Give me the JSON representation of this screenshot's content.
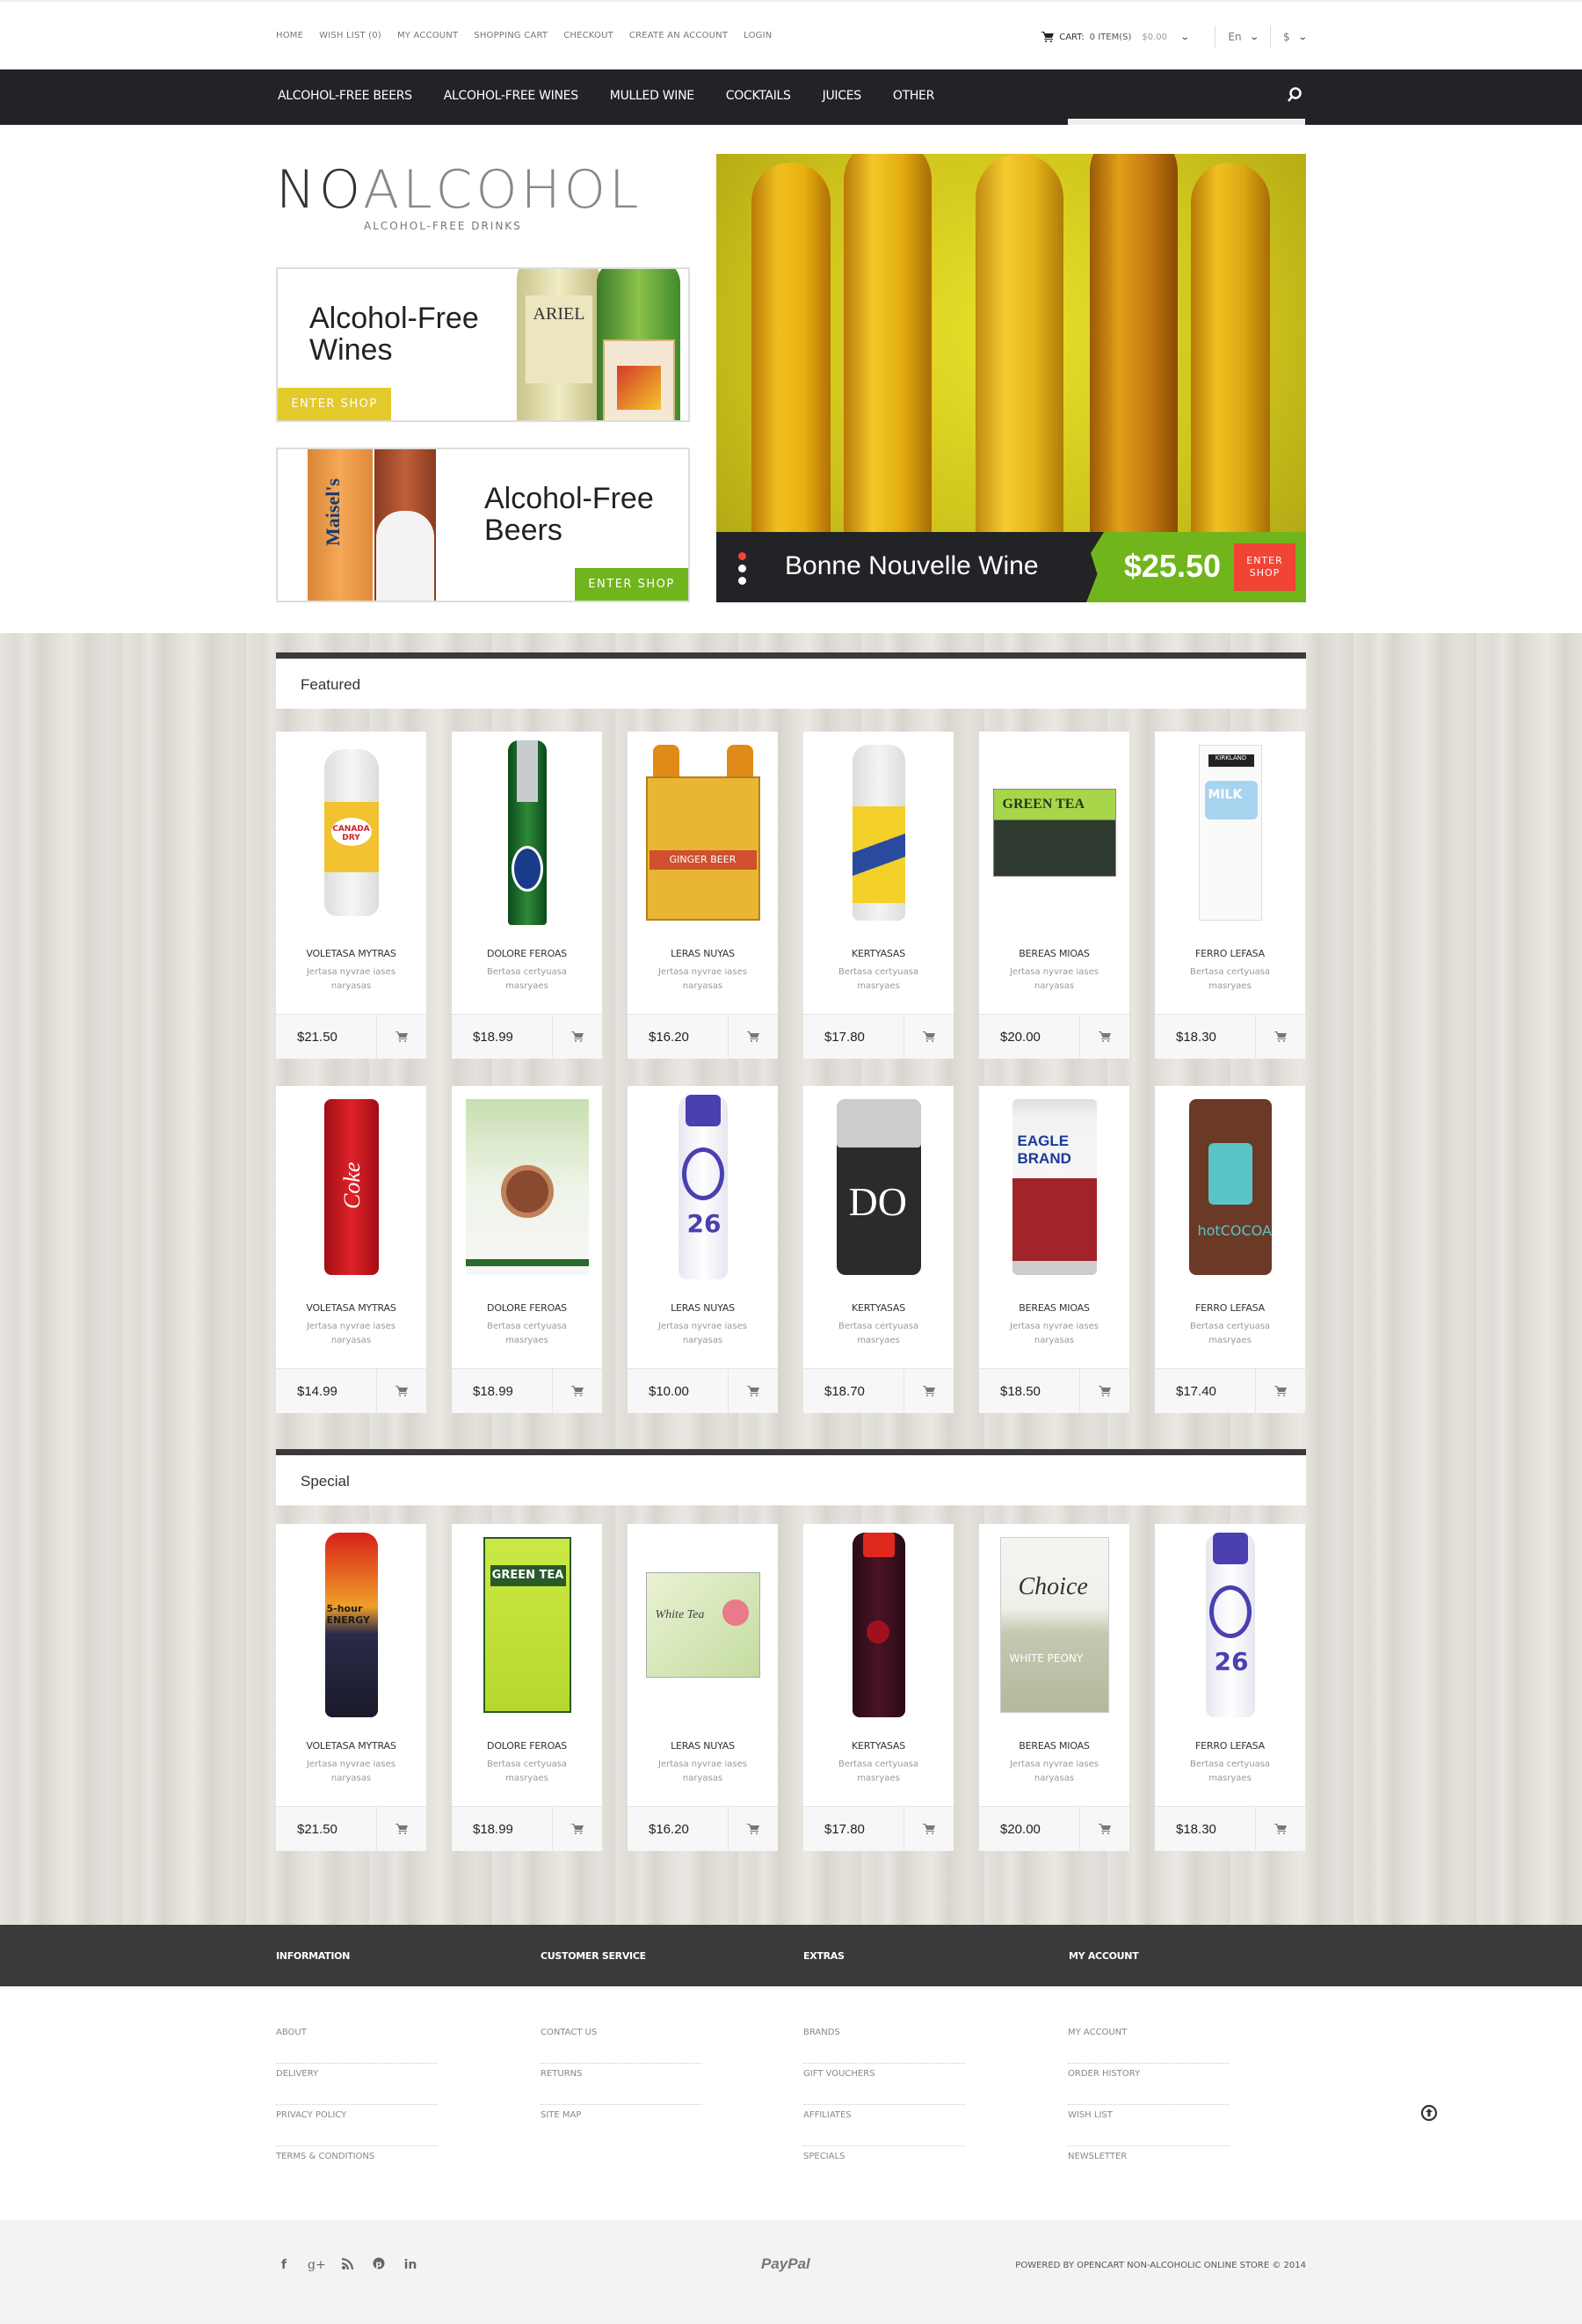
{
  "topbar": {
    "links": [
      "HOME",
      "WISH LIST (0)",
      "MY ACCOUNT",
      "SHOPPING CART",
      "CHECKOUT",
      "CREATE AN ACCOUNT",
      "LOGIN"
    ],
    "cart_label": "CART:",
    "cart_items": "0 ITEM(S)",
    "cart_total": "$0.00",
    "language": "En",
    "currency": "$"
  },
  "nav": {
    "items": [
      "ALCOHOL-FREE BEERS",
      "ALCOHOL-FREE WINES",
      "MULLED WINE",
      "COCKTAILS",
      "JUICES",
      "OTHER"
    ]
  },
  "logo": {
    "no": "NO",
    "rest": "ALCOHOL",
    "tagline": "ALCOHOL-FREE DRINKS"
  },
  "banners": [
    {
      "title_line1": "Alcohol-Free",
      "title_line2": "Wines",
      "button": "ENTER SHOP",
      "color": "#e3c92c"
    },
    {
      "title_line1": "Alcohol-Free",
      "title_line2": "Beers",
      "button": "ENTER SHOP",
      "color": "#70b51c"
    }
  ],
  "hero": {
    "product_name": "Bonne Nouvelle Wine",
    "price": "$25.50",
    "button_line1": "ENTER",
    "button_line2": "SHOP",
    "accent_green": "#70b51c",
    "accent_red": "#f04435"
  },
  "featured": {
    "title": "Featured",
    "products": [
      {
        "name": "VOLETASA MYTRAS",
        "desc": "Jertasa nyvrae iases naryasas",
        "price": "$21.50",
        "image": "canada-dry-tonic-bottle"
      },
      {
        "name": "DOLORE FEROAS",
        "desc": "Bertasa certyuasa masryaes",
        "price": "$18.99",
        "image": "becks-beer-bottle"
      },
      {
        "name": "LERAS NUYAS",
        "desc": "Jertasa nyvrae iases naryasas",
        "price": "$16.20",
        "image": "bundaberg-ginger-beer-pack"
      },
      {
        "name": "KERTYASAS",
        "desc": "Bertasa certyuasa masryaes",
        "price": "$17.80",
        "image": "canfields-tonic-bottle"
      },
      {
        "name": "BEREAS MIOAS",
        "desc": "Jertasa nyvrae iases naryasas",
        "price": "$20.00",
        "image": "celestial-green-tea-box"
      },
      {
        "name": "FERRO LEFASA",
        "desc": "Bertasa certyuasa masryaes",
        "price": "$18.30",
        "image": "kirkland-chocolate-milk"
      },
      {
        "name": "VOLETASA MYTRAS",
        "desc": "Jertasa nyvrae iases naryasas",
        "price": "$14.99",
        "image": "coca-cola-can"
      },
      {
        "name": "DOLORE FEROAS",
        "desc": "Bertasa certyuasa masryaes",
        "price": "$18.99",
        "image": "coffee-bean-bag"
      },
      {
        "name": "LERAS NUYAS",
        "desc": "Jertasa nyvrae iases naryasas",
        "price": "$10.00",
        "image": "core-power-bottle"
      },
      {
        "name": "KERTYASAS",
        "desc": "Bertasa certyuasa masryaes",
        "price": "$18.70",
        "image": "do-matcha-tin"
      },
      {
        "name": "BEREAS MIOAS",
        "desc": "Jertasa nyvrae iases naryasas",
        "price": "$18.50",
        "image": "eagle-brand-milk-can"
      },
      {
        "name": "FERRO LEFASA",
        "desc": "Bertasa certyuasa masryaes",
        "price": "$17.40",
        "image": "hot-cocoa-tin"
      }
    ]
  },
  "special": {
    "title": "Special",
    "products": [
      {
        "name": "VOLETASA MYTRAS",
        "desc": "Jertasa nyvrae iases naryasas",
        "price": "$21.50",
        "image": "5-hour-energy-bottle"
      },
      {
        "name": "DOLORE FEROAS",
        "desc": "Bertasa certyuasa masryaes",
        "price": "$18.99",
        "image": "bigelow-green-tea-box"
      },
      {
        "name": "LERAS NUYAS",
        "desc": "Jertasa nyvrae iases naryasas",
        "price": "$16.20",
        "image": "bigelow-white-tea-box"
      },
      {
        "name": "KERTYASAS",
        "desc": "Bertasa certyuasa masryaes",
        "price": "$17.80",
        "image": "cherry-juice-bottle"
      },
      {
        "name": "BEREAS MIOAS",
        "desc": "Jertasa nyvrae iases naryasas",
        "price": "$20.00",
        "image": "choice-white-peony-box"
      },
      {
        "name": "FERRO LEFASA",
        "desc": "Bertasa certyuasa masryaes",
        "price": "$18.30",
        "image": "core-power-bottle"
      }
    ]
  },
  "footer": {
    "columns": [
      {
        "title": "INFORMATION",
        "links": [
          "ABOUT",
          "DELIVERY",
          "PRIVACY POLICY",
          "TERMS & CONDITIONS"
        ]
      },
      {
        "title": "CUSTOMER SERVICE",
        "links": [
          "CONTACT US",
          "RETURNS",
          "SITE MAP"
        ]
      },
      {
        "title": "EXTRAS",
        "links": [
          "BRANDS",
          "GIFT VOUCHERS",
          "AFFILIATES",
          "SPECIALS"
        ]
      },
      {
        "title": "MY ACCOUNT",
        "links": [
          "MY ACCOUNT",
          "ORDER HISTORY",
          "WISH LIST",
          "NEWSLETTER"
        ]
      }
    ],
    "social": [
      {
        "icon": "facebook-icon",
        "glyph": "f"
      },
      {
        "icon": "google-plus-icon",
        "glyph": "g+"
      },
      {
        "icon": "rss-icon",
        "glyph": "⟆"
      },
      {
        "icon": "pinterest-icon",
        "glyph": "℗"
      },
      {
        "icon": "linkedin-icon",
        "glyph": "in"
      }
    ],
    "payment": "PayPal",
    "copyright": "POWERED BY OPENCART NON-ALCOHOLIC ONLINE STORE © 2014"
  }
}
